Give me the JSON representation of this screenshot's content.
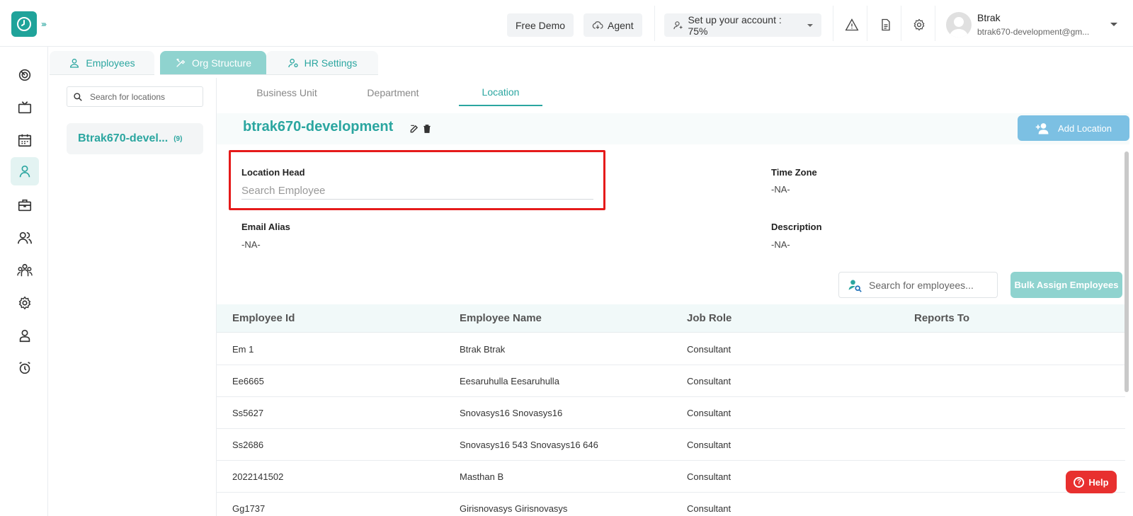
{
  "topbar": {
    "free_demo": "Free Demo",
    "agent": "Agent",
    "setup": "Set up your account : 75%",
    "user_name": "Btrak",
    "user_email": "btrak670-development@gm..."
  },
  "main_tabs": [
    {
      "label": "Employees"
    },
    {
      "label": "Org Structure"
    },
    {
      "label": "HR Settings"
    }
  ],
  "locations_panel": {
    "search_placeholder": "Search for locations",
    "item_name": "Btrak670-devel...",
    "item_count": "(9)"
  },
  "sub_tabs": [
    {
      "label": "Business Unit"
    },
    {
      "label": "Department"
    },
    {
      "label": "Location"
    }
  ],
  "location": {
    "title": "btrak670-development",
    "add_button": "Add Location",
    "head_label": "Location Head",
    "head_placeholder": "Search Employee",
    "timezone_label": "Time Zone",
    "timezone_value": "-NA-",
    "email_label": "Email Alias",
    "email_value": "-NA-",
    "description_label": "Description",
    "description_value": "-NA-"
  },
  "employees": {
    "search_placeholder": "Search for employees...",
    "bulk_button": "Bulk Assign Employees",
    "columns": [
      "Employee Id",
      "Employee Name",
      "Job Role",
      "Reports To"
    ],
    "rows": [
      [
        "Em 1",
        "Btrak Btrak",
        "Consultant",
        ""
      ],
      [
        "Ee6665",
        "Eesaruhulla Eesaruhulla",
        "Consultant",
        ""
      ],
      [
        "Ss5627",
        "Snovasys16 Snovasys16",
        "Consultant",
        ""
      ],
      [
        "Ss2686",
        "Snovasys16 543 Snovasys16 646",
        "Consultant",
        ""
      ],
      [
        "2022141502",
        "Masthan B",
        "Consultant",
        ""
      ],
      [
        "Gg1737",
        "Girisnovasys Girisnovasys",
        "Consultant",
        ""
      ]
    ]
  },
  "help_label": "Help",
  "colors": {
    "accent": "#2ba6a0",
    "tab_active": "#8fd3cf",
    "add_button": "#7cc0e3",
    "highlight": "#e51a1a",
    "help": "#e8302f"
  }
}
